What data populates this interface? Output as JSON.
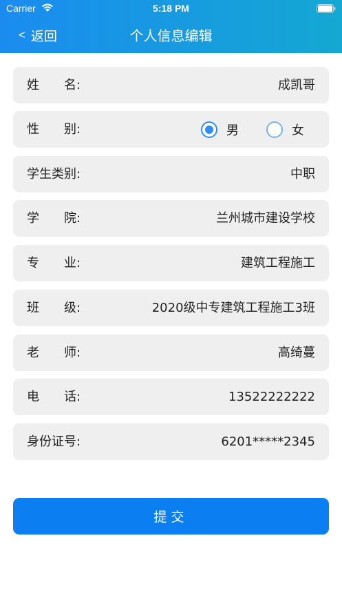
{
  "status_bar": {
    "carrier": "Carrier",
    "time": "5:18 PM"
  },
  "nav": {
    "back_label": "返回",
    "back_chevron": "<",
    "title": "个人信息编辑"
  },
  "form": {
    "name": {
      "label": "姓　　名:",
      "value": "成凯哥"
    },
    "gender": {
      "label": "性　　别:",
      "options": [
        "男",
        "女"
      ],
      "selected": "男"
    },
    "student_type": {
      "label": "学生类别:",
      "value": "中职"
    },
    "college": {
      "label": "学　　院:",
      "value": "兰州城市建设学校"
    },
    "major": {
      "label": "专　　业:",
      "value": "建筑工程施工"
    },
    "class": {
      "label": "班　　级:",
      "value": "2020级中专建筑工程施工3班"
    },
    "teacher": {
      "label": "老　　师:",
      "value": "高绮蔓"
    },
    "phone": {
      "label": "电　　话:",
      "value": "13522222222"
    },
    "id_number": {
      "label": "身份证号:",
      "value": "6201*****2345"
    }
  },
  "submit": {
    "label": "提交"
  },
  "colors": {
    "header_start": "#1a8cf0",
    "header_end": "#14a8d2",
    "row_bg": "#efefef",
    "accent": "#0b7ff2"
  }
}
